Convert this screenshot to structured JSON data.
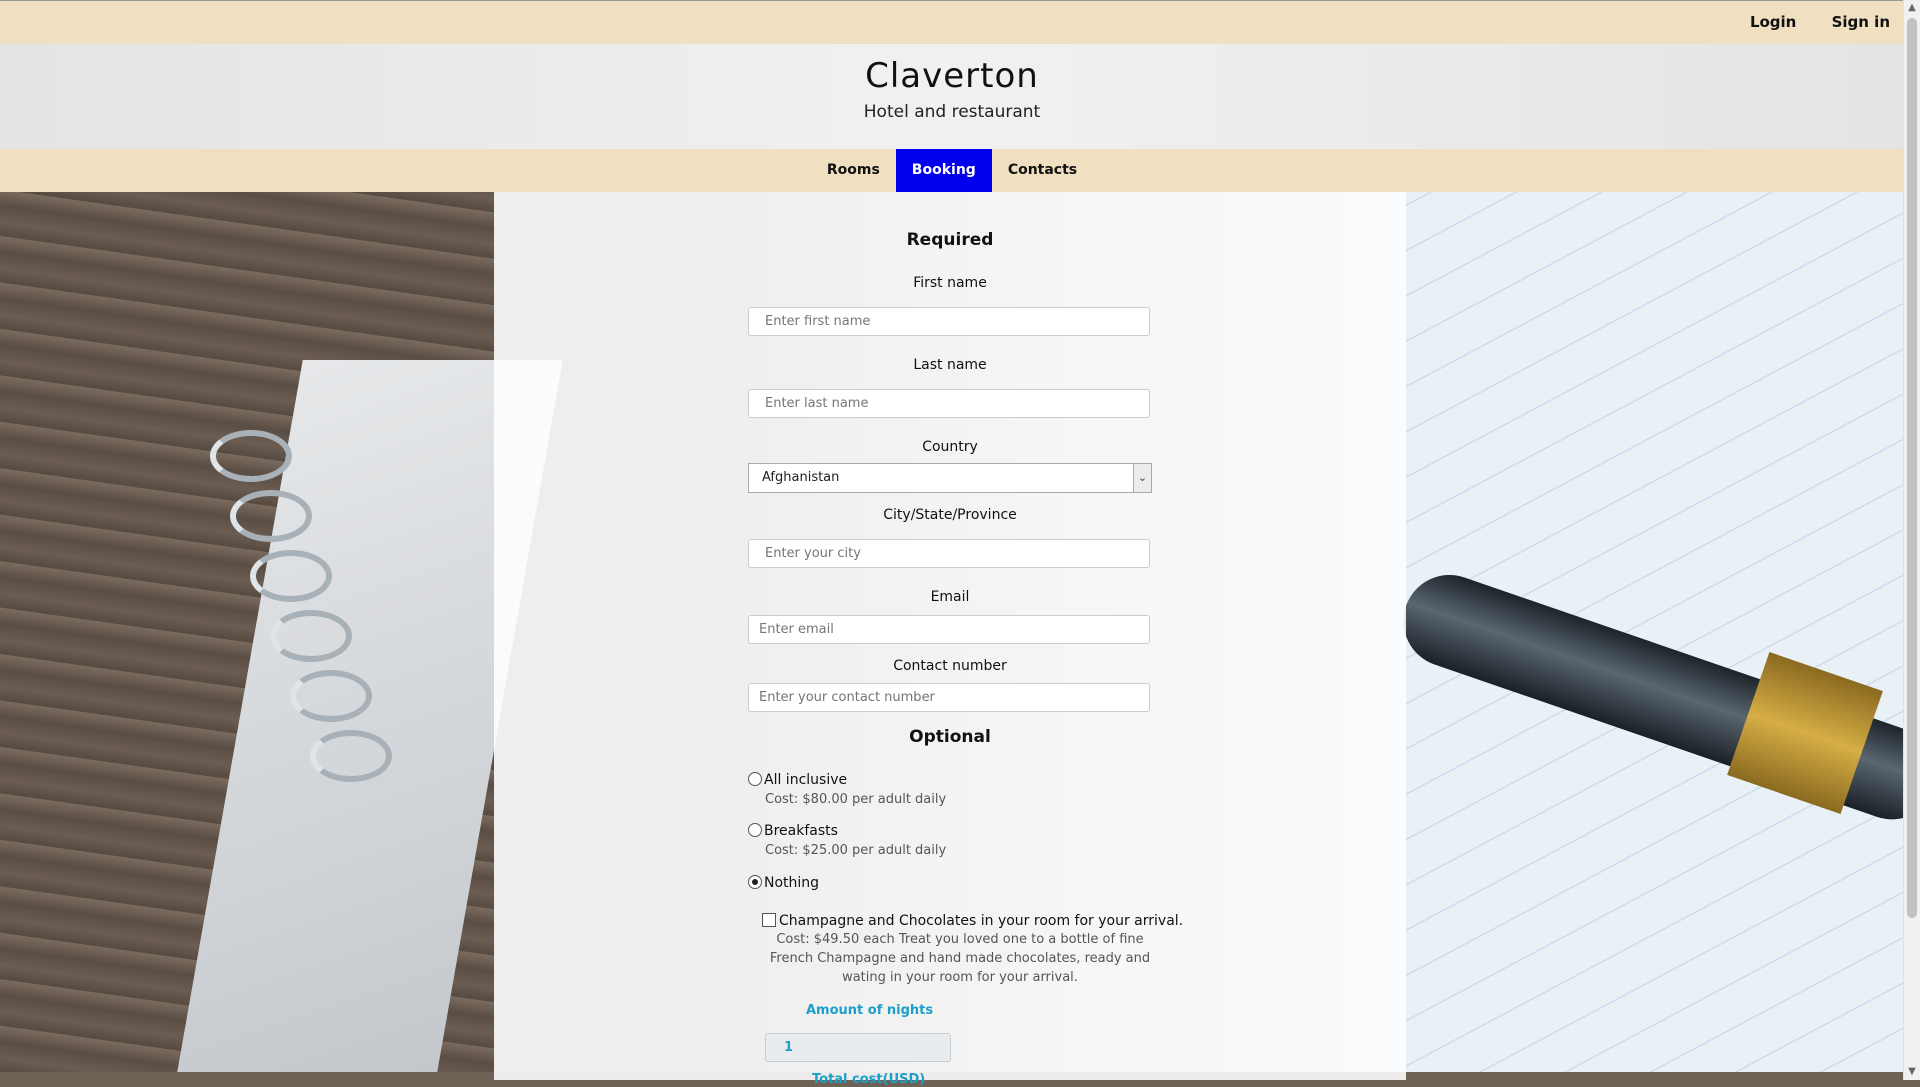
{
  "topbar": {
    "login": "Login",
    "sign_in": "Sign in"
  },
  "header": {
    "title": "Claverton",
    "subtitle": "Hotel and restaurant"
  },
  "nav": {
    "items": [
      "Rooms",
      "Booking",
      "Contacts"
    ],
    "active": "Booking"
  },
  "form": {
    "required_title": "Required",
    "first_name": {
      "label": "First name",
      "placeholder": "Enter first name"
    },
    "last_name": {
      "label": "Last name",
      "placeholder": "Enter last name"
    },
    "country": {
      "label": "Country",
      "value": "Afghanistan"
    },
    "city": {
      "label": "City/State/Province",
      "placeholder": "Enter your city"
    },
    "email": {
      "label": "Email",
      "placeholder": "Enter email"
    },
    "contact": {
      "label": "Contact number",
      "placeholder": "Enter your contact number"
    },
    "optional_title": "Optional",
    "options": [
      {
        "label": "All inclusive",
        "cost": "Cost: $80.00 per adult daily",
        "checked": false
      },
      {
        "label": "Breakfasts",
        "cost": "Cost: $25.00 per adult daily",
        "checked": false
      },
      {
        "label": "Nothing",
        "cost": "",
        "checked": true
      }
    ],
    "extra": {
      "label": "Champagne and Chocolates in your room for your arrival.",
      "description": "Cost: $49.50 each Treat you loved one to a bottle of fine French Champagne and hand made chocolates, ready and wating in your room for your arrival."
    },
    "nights": {
      "label": "Amount of nights",
      "value": "1"
    },
    "total_label": "Total cost(USD)"
  },
  "colors": {
    "accent_blue": "#0000ee",
    "bar_beige": "#f0dfc1",
    "teal": "#1aa0c9"
  }
}
